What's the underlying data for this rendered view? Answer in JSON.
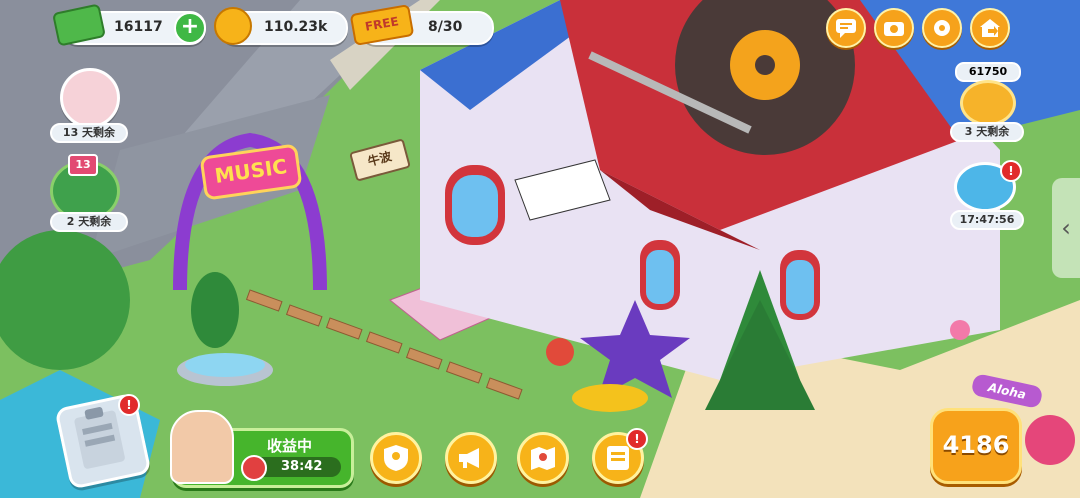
{
  "currencies": {
    "cash": "16117",
    "coins": "110.23k",
    "free_label": "FREE",
    "free_count": "8/30"
  },
  "events": [
    {
      "time_left": "13 天剩余"
    },
    {
      "level": "13",
      "time_left": "2 天剩余"
    }
  ],
  "right_panel": {
    "piggy_amount": "61750",
    "piggy_time_left": "3 天剩余",
    "dive_timer": "17:47:56",
    "badge_mark": "!"
  },
  "income": {
    "label": "收益中",
    "timer": "38:42"
  },
  "scene": {
    "music_sign": "MUSIC",
    "shop_sign": "牛波",
    "aloha_sign": "Aloha"
  },
  "tickets": "4186",
  "colors": {
    "accent": "#f6a21b",
    "badge": "#e12b2b",
    "income_green": "#46b52c"
  },
  "icons": [
    "chat-icon",
    "camera-icon",
    "gear-icon",
    "home-exit-icon",
    "shield-icon",
    "megaphone-icon",
    "map-icon",
    "schedule-icon",
    "clipboard-icon"
  ]
}
